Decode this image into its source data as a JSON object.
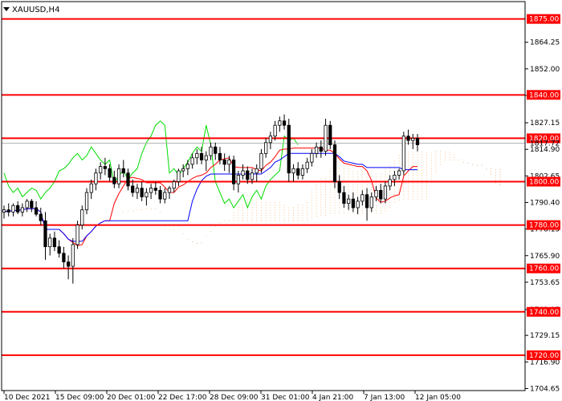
{
  "chart_data": {
    "type": "candlestick",
    "symbol": "XAUUSD,H4",
    "ylim": [
      1703.7,
      1883.0
    ],
    "price_ticks": [
      1864.25,
      1852.0,
      1839.75,
      1827.15,
      1814.9,
      1802.65,
      1790.4,
      1778.15,
      1765.9,
      1753.65,
      1741.05,
      1729.15,
      1716.9,
      1704.65
    ],
    "time_labels": [
      "10 Dec 2021",
      "15 Dec 09:00",
      "20 Dec 01:00",
      "22 Dec 17:00",
      "28 Dec 09:00",
      "31 Dec 01:00",
      "4 Jan 21:00",
      "7 Jan 13:00",
      "12 Jan 05:00"
    ],
    "level_lines": [
      1875.0,
      1840.0,
      1820.0,
      1800.0,
      1780.0,
      1760.0,
      1740.0,
      1720.0
    ],
    "current_price": 1817.72,
    "ohlc": [
      [
        1786,
        1789,
        1783,
        1787
      ],
      [
        1787,
        1790,
        1784,
        1786
      ],
      [
        1786,
        1790,
        1784,
        1789
      ],
      [
        1789,
        1791,
        1785,
        1786
      ],
      [
        1786,
        1790,
        1784,
        1788
      ],
      [
        1788,
        1792,
        1786,
        1791
      ],
      [
        1791,
        1792,
        1786,
        1788
      ],
      [
        1788,
        1791,
        1784,
        1785
      ],
      [
        1785,
        1788,
        1780,
        1782
      ],
      [
        1782,
        1786,
        1764,
        1770
      ],
      [
        1770,
        1776,
        1766,
        1774
      ],
      [
        1774,
        1777,
        1768,
        1770
      ],
      [
        1770,
        1773,
        1765,
        1767
      ],
      [
        1767,
        1770,
        1760,
        1763
      ],
      [
        1763,
        1766,
        1755,
        1761
      ],
      [
        1761,
        1774,
        1753,
        1771
      ],
      [
        1771,
        1782,
        1769,
        1780
      ],
      [
        1780,
        1789,
        1778,
        1787
      ],
      [
        1787,
        1797,
        1785,
        1795
      ],
      [
        1795,
        1801,
        1792,
        1799
      ],
      [
        1799,
        1806,
        1796,
        1804
      ],
      [
        1804,
        1809,
        1801,
        1807
      ],
      [
        1807,
        1811,
        1803,
        1806
      ],
      [
        1806,
        1808,
        1800,
        1802
      ],
      [
        1802,
        1805,
        1797,
        1799
      ],
      [
        1799,
        1808,
        1797,
        1806
      ],
      [
        1806,
        1810,
        1802,
        1804
      ],
      [
        1804,
        1806,
        1796,
        1798
      ],
      [
        1798,
        1801,
        1793,
        1795
      ],
      [
        1795,
        1799,
        1792,
        1797
      ],
      [
        1797,
        1800,
        1791,
        1793
      ],
      [
        1793,
        1797,
        1789,
        1795
      ],
      [
        1795,
        1799,
        1792,
        1797
      ],
      [
        1797,
        1800,
        1794,
        1796
      ],
      [
        1796,
        1798,
        1790,
        1792
      ],
      [
        1792,
        1797,
        1790,
        1795
      ],
      [
        1795,
        1798,
        1792,
        1797
      ],
      [
        1797,
        1801,
        1795,
        1800
      ],
      [
        1800,
        1806,
        1798,
        1805
      ],
      [
        1805,
        1808,
        1802,
        1806
      ],
      [
        1806,
        1810,
        1803,
        1808
      ],
      [
        1808,
        1813,
        1806,
        1811
      ],
      [
        1811,
        1815,
        1808,
        1813
      ],
      [
        1813,
        1816,
        1808,
        1810
      ],
      [
        1810,
        1814,
        1805,
        1812
      ],
      [
        1812,
        1818,
        1810,
        1816
      ],
      [
        1816,
        1818,
        1810,
        1813
      ],
      [
        1813,
        1816,
        1808,
        1810
      ],
      [
        1810,
        1813,
        1805,
        1808
      ],
      [
        1808,
        1812,
        1804,
        1810
      ],
      [
        1810,
        1812,
        1796,
        1799
      ],
      [
        1799,
        1805,
        1795,
        1803
      ],
      [
        1803,
        1808,
        1801,
        1805
      ],
      [
        1805,
        1807,
        1799,
        1801
      ],
      [
        1801,
        1806,
        1799,
        1804
      ],
      [
        1804,
        1808,
        1800,
        1806
      ],
      [
        1806,
        1815,
        1804,
        1813
      ],
      [
        1813,
        1820,
        1811,
        1818
      ],
      [
        1818,
        1823,
        1815,
        1821
      ],
      [
        1821,
        1828,
        1819,
        1826
      ],
      [
        1826,
        1830,
        1823,
        1828
      ],
      [
        1828,
        1831,
        1824,
        1826
      ],
      [
        1826,
        1829,
        1800,
        1804
      ],
      [
        1804,
        1808,
        1800,
        1806
      ],
      [
        1806,
        1809,
        1801,
        1803
      ],
      [
        1803,
        1808,
        1801,
        1806
      ],
      [
        1806,
        1811,
        1804,
        1809
      ],
      [
        1809,
        1815,
        1807,
        1813
      ],
      [
        1813,
        1818,
        1811,
        1816
      ],
      [
        1816,
        1819,
        1811,
        1814
      ],
      [
        1814,
        1829,
        1812,
        1826
      ],
      [
        1826,
        1828,
        1815,
        1817
      ],
      [
        1817,
        1819,
        1797,
        1800
      ],
      [
        1800,
        1803,
        1792,
        1795
      ],
      [
        1795,
        1798,
        1788,
        1790
      ],
      [
        1790,
        1794,
        1787,
        1792
      ],
      [
        1792,
        1795,
        1786,
        1788
      ],
      [
        1788,
        1793,
        1785,
        1791
      ],
      [
        1791,
        1796,
        1789,
        1794
      ],
      [
        1794,
        1797,
        1782,
        1788
      ],
      [
        1788,
        1795,
        1786,
        1793
      ],
      [
        1793,
        1798,
        1791,
        1796
      ],
      [
        1796,
        1799,
        1790,
        1792
      ],
      [
        1792,
        1800,
        1790,
        1798
      ],
      [
        1798,
        1803,
        1796,
        1801
      ],
      [
        1801,
        1805,
        1798,
        1803
      ],
      [
        1803,
        1806,
        1801,
        1805
      ],
      [
        1805,
        1823,
        1803,
        1821
      ],
      [
        1821,
        1824,
        1817,
        1819
      ],
      [
        1819,
        1822,
        1815,
        1820
      ],
      [
        1820,
        1822,
        1814,
        1817
      ]
    ]
  }
}
